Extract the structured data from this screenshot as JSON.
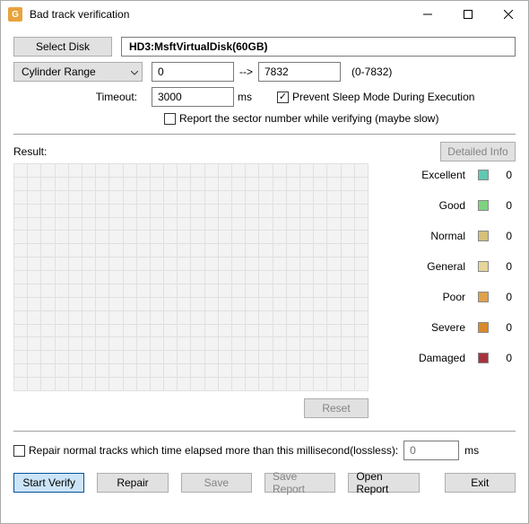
{
  "window": {
    "title": "Bad track verification"
  },
  "top": {
    "select_disk": "Select Disk",
    "disk_name": "HD3:MsftVirtualDisk(60GB)",
    "cyl_label": "Cylinder Range",
    "cyl_from": "0",
    "cyl_arrow": "-->",
    "cyl_to": "7832",
    "cyl_hint": "(0-7832)",
    "timeout_label": "Timeout:",
    "timeout_value": "3000",
    "ms": "ms",
    "prevent_sleep": "Prevent Sleep Mode During Execution",
    "report_sector": "Report the sector number while verifying (maybe slow)"
  },
  "result": {
    "label": "Result:",
    "detailed": "Detailed Info",
    "reset": "Reset",
    "legend": [
      {
        "name": "Excellent",
        "color": "#5fc9b3",
        "count": "0"
      },
      {
        "name": "Good",
        "color": "#7ed37e",
        "count": "0"
      },
      {
        "name": "Normal",
        "color": "#d6c07a",
        "count": "0"
      },
      {
        "name": "General",
        "color": "#e6d699",
        "count": "0"
      },
      {
        "name": "Poor",
        "color": "#e0a24a",
        "count": "0"
      },
      {
        "name": "Severe",
        "color": "#d98b2b",
        "count": "0"
      },
      {
        "name": "Damaged",
        "color": "#a8323c",
        "count": "0"
      }
    ]
  },
  "repair": {
    "label": "Repair normal tracks which time elapsed more than this millisecond(lossless):",
    "value": "0",
    "ms": "ms"
  },
  "buttons": {
    "start": "Start Verify",
    "repair": "Repair",
    "save": "Save",
    "save_report": "Save Report",
    "open_report": "Open Report",
    "exit": "Exit"
  }
}
